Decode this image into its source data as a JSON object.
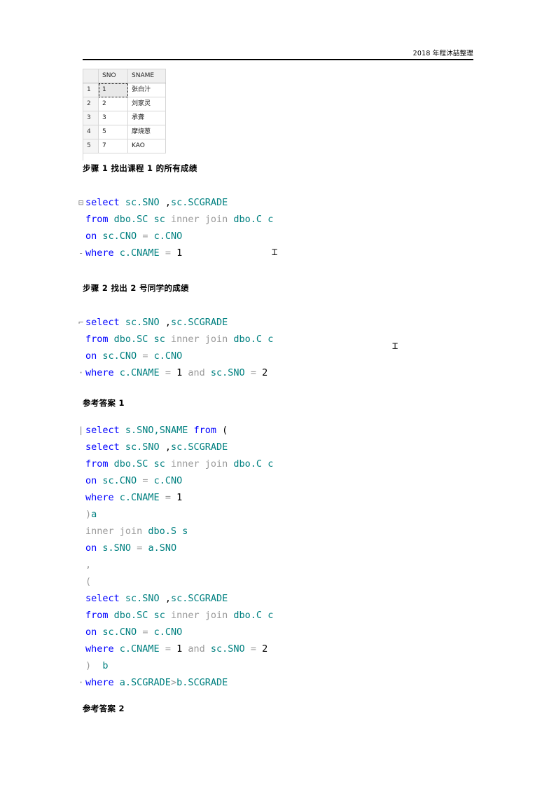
{
  "header": {
    "text": "2018 年程沐喆整理"
  },
  "result_grid": {
    "columns": [
      "",
      "SNO",
      "SNAME"
    ],
    "rows": [
      {
        "n": "1",
        "sno": "1",
        "sname": "张白汁",
        "selected": true
      },
      {
        "n": "2",
        "sno": "2",
        "sname": "刘家灵",
        "selected": false
      },
      {
        "n": "3",
        "sno": "3",
        "sname": "承聋",
        "selected": false
      },
      {
        "n": "4",
        "sno": "5",
        "sname": "摩烧葱",
        "selected": false
      },
      {
        "n": "5",
        "sno": "7",
        "sname": "KAO",
        "selected": false
      }
    ]
  },
  "sections": {
    "step1_heading": "步骤 1  找出课程 1 的所有成绩",
    "step2_heading": "步骤 2 找出 2 号同学的成绩",
    "answer1_heading": "参考答案 1",
    "answer2_heading": "参考答案 2"
  },
  "code_blocks": {
    "step1": {
      "lines": [
        {
          "gutter": "⊟",
          "tokens": [
            {
              "t": "select",
              "c": "kw"
            },
            {
              "t": " ",
              "c": "pl"
            },
            {
              "t": "sc.SNO",
              "c": "id"
            },
            {
              "t": " ,",
              "c": "pl"
            },
            {
              "t": "sc.SCGRADE",
              "c": "id"
            }
          ]
        },
        {
          "gutter": " ",
          "tokens": [
            {
              "t": "from",
              "c": "kw"
            },
            {
              "t": " ",
              "c": "pl"
            },
            {
              "t": "dbo.SC",
              "c": "id"
            },
            {
              "t": " ",
              "c": "pl"
            },
            {
              "t": "sc",
              "c": "id"
            },
            {
              "t": " ",
              "c": "pl"
            },
            {
              "t": "inner join",
              "c": "gry"
            },
            {
              "t": " ",
              "c": "pl"
            },
            {
              "t": "dbo.C",
              "c": "id"
            },
            {
              "t": " ",
              "c": "pl"
            },
            {
              "t": "c",
              "c": "id"
            }
          ]
        },
        {
          "gutter": " ",
          "tokens": [
            {
              "t": "on",
              "c": "kw"
            },
            {
              "t": " ",
              "c": "pl"
            },
            {
              "t": "sc.CNO",
              "c": "id"
            },
            {
              "t": " ",
              "c": "pl"
            },
            {
              "t": "=",
              "c": "gry"
            },
            {
              "t": " ",
              "c": "pl"
            },
            {
              "t": "c.CNO",
              "c": "id"
            }
          ]
        },
        {
          "gutter": "-",
          "tokens": [
            {
              "t": "where",
              "c": "kw"
            },
            {
              "t": " ",
              "c": "pl"
            },
            {
              "t": "c.CNAME",
              "c": "id"
            },
            {
              "t": " ",
              "c": "pl"
            },
            {
              "t": "=",
              "c": "gry"
            },
            {
              "t": " ",
              "c": "pl"
            },
            {
              "t": "1",
              "c": "num"
            }
          ]
        }
      ]
    },
    "step2": {
      "lines": [
        {
          "gutter": "⌐",
          "tokens": [
            {
              "t": "select",
              "c": "kw"
            },
            {
              "t": " ",
              "c": "pl"
            },
            {
              "t": "sc.SNO",
              "c": "id"
            },
            {
              "t": " ,",
              "c": "pl"
            },
            {
              "t": "sc.SCGRADE",
              "c": "id"
            }
          ]
        },
        {
          "gutter": " ",
          "tokens": [
            {
              "t": "from",
              "c": "kw"
            },
            {
              "t": " ",
              "c": "pl"
            },
            {
              "t": "dbo.SC",
              "c": "id"
            },
            {
              "t": " ",
              "c": "pl"
            },
            {
              "t": "sc",
              "c": "id"
            },
            {
              "t": " ",
              "c": "pl"
            },
            {
              "t": "inner join",
              "c": "gry"
            },
            {
              "t": " ",
              "c": "pl"
            },
            {
              "t": "dbo.C",
              "c": "id"
            },
            {
              "t": " ",
              "c": "pl"
            },
            {
              "t": "c",
              "c": "id"
            }
          ]
        },
        {
          "gutter": " ",
          "tokens": [
            {
              "t": "on",
              "c": "kw"
            },
            {
              "t": " ",
              "c": "pl"
            },
            {
              "t": "sc.CNO",
              "c": "id"
            },
            {
              "t": " ",
              "c": "pl"
            },
            {
              "t": "=",
              "c": "gry"
            },
            {
              "t": " ",
              "c": "pl"
            },
            {
              "t": "c.CNO",
              "c": "id"
            }
          ]
        },
        {
          "gutter": "·",
          "tokens": [
            {
              "t": "where",
              "c": "kw"
            },
            {
              "t": " ",
              "c": "pl"
            },
            {
              "t": "c.CNAME",
              "c": "id"
            },
            {
              "t": " ",
              "c": "pl"
            },
            {
              "t": "=",
              "c": "gry"
            },
            {
              "t": " ",
              "c": "pl"
            },
            {
              "t": "1",
              "c": "num"
            },
            {
              "t": " ",
              "c": "pl"
            },
            {
              "t": "and",
              "c": "gry"
            },
            {
              "t": " ",
              "c": "pl"
            },
            {
              "t": "sc.SNO",
              "c": "id"
            },
            {
              "t": " ",
              "c": "pl"
            },
            {
              "t": "=",
              "c": "gry"
            },
            {
              "t": " ",
              "c": "pl"
            },
            {
              "t": "2",
              "c": "num"
            }
          ]
        }
      ]
    },
    "answer1": {
      "lines": [
        {
          "gutter": "|",
          "tokens": [
            {
              "t": "select",
              "c": "kw"
            },
            {
              "t": " ",
              "c": "pl"
            },
            {
              "t": "s.SNO,SNAME",
              "c": "id"
            },
            {
              "t": " ",
              "c": "pl"
            },
            {
              "t": "from",
              "c": "kw"
            },
            {
              "t": " (",
              "c": "pl"
            }
          ]
        },
        {
          "gutter": " ",
          "tokens": [
            {
              "t": "select",
              "c": "kw"
            },
            {
              "t": " ",
              "c": "pl"
            },
            {
              "t": "sc.SNO",
              "c": "id"
            },
            {
              "t": " ,",
              "c": "pl"
            },
            {
              "t": "sc.SCGRADE",
              "c": "id"
            }
          ]
        },
        {
          "gutter": " ",
          "tokens": [
            {
              "t": "from",
              "c": "kw"
            },
            {
              "t": " ",
              "c": "pl"
            },
            {
              "t": "dbo.SC",
              "c": "id"
            },
            {
              "t": " ",
              "c": "pl"
            },
            {
              "t": "sc",
              "c": "id"
            },
            {
              "t": " ",
              "c": "pl"
            },
            {
              "t": "inner join",
              "c": "gry"
            },
            {
              "t": " ",
              "c": "pl"
            },
            {
              "t": "dbo.C",
              "c": "id"
            },
            {
              "t": " ",
              "c": "pl"
            },
            {
              "t": "c",
              "c": "id"
            }
          ]
        },
        {
          "gutter": " ",
          "tokens": [
            {
              "t": "on",
              "c": "kw"
            },
            {
              "t": " ",
              "c": "pl"
            },
            {
              "t": "sc.CNO",
              "c": "id"
            },
            {
              "t": " ",
              "c": "pl"
            },
            {
              "t": "=",
              "c": "gry"
            },
            {
              "t": " ",
              "c": "pl"
            },
            {
              "t": "c.CNO",
              "c": "id"
            }
          ]
        },
        {
          "gutter": " ",
          "tokens": [
            {
              "t": "where",
              "c": "kw"
            },
            {
              "t": " ",
              "c": "pl"
            },
            {
              "t": "c.CNAME",
              "c": "id"
            },
            {
              "t": " ",
              "c": "pl"
            },
            {
              "t": "=",
              "c": "gry"
            },
            {
              "t": " ",
              "c": "pl"
            },
            {
              "t": "1",
              "c": "num"
            }
          ]
        },
        {
          "gutter": " ",
          "tokens": [
            {
              "t": ")",
              "c": "gry"
            },
            {
              "t": "a",
              "c": "alias"
            }
          ]
        },
        {
          "gutter": " ",
          "tokens": [
            {
              "t": "inner join",
              "c": "gry"
            },
            {
              "t": " ",
              "c": "pl"
            },
            {
              "t": "dbo.S",
              "c": "id"
            },
            {
              "t": " ",
              "c": "pl"
            },
            {
              "t": "s",
              "c": "id"
            }
          ]
        },
        {
          "gutter": " ",
          "tokens": [
            {
              "t": "on",
              "c": "kw"
            },
            {
              "t": " ",
              "c": "pl"
            },
            {
              "t": "s.SNO",
              "c": "id"
            },
            {
              "t": " ",
              "c": "pl"
            },
            {
              "t": "=",
              "c": "gry"
            },
            {
              "t": " ",
              "c": "pl"
            },
            {
              "t": "a.SNO",
              "c": "id"
            }
          ]
        },
        {
          "gutter": " ",
          "tokens": [
            {
              "t": ",",
              "c": "gry"
            }
          ]
        },
        {
          "gutter": " ",
          "tokens": [
            {
              "t": "(",
              "c": "gry"
            }
          ]
        },
        {
          "gutter": " ",
          "tokens": [
            {
              "t": "select",
              "c": "kw"
            },
            {
              "t": " ",
              "c": "pl"
            },
            {
              "t": "sc.SNO",
              "c": "id"
            },
            {
              "t": " ,",
              "c": "pl"
            },
            {
              "t": "sc.SCGRADE",
              "c": "id"
            }
          ]
        },
        {
          "gutter": " ",
          "tokens": [
            {
              "t": "from",
              "c": "kw"
            },
            {
              "t": " ",
              "c": "pl"
            },
            {
              "t": "dbo.SC",
              "c": "id"
            },
            {
              "t": " ",
              "c": "pl"
            },
            {
              "t": "sc",
              "c": "id"
            },
            {
              "t": " ",
              "c": "pl"
            },
            {
              "t": "inner join",
              "c": "gry"
            },
            {
              "t": " ",
              "c": "pl"
            },
            {
              "t": "dbo.C",
              "c": "id"
            },
            {
              "t": " ",
              "c": "pl"
            },
            {
              "t": "c",
              "c": "id"
            }
          ]
        },
        {
          "gutter": " ",
          "tokens": [
            {
              "t": "on",
              "c": "kw"
            },
            {
              "t": " ",
              "c": "pl"
            },
            {
              "t": "sc.CNO",
              "c": "id"
            },
            {
              "t": " ",
              "c": "pl"
            },
            {
              "t": "=",
              "c": "gry"
            },
            {
              "t": " ",
              "c": "pl"
            },
            {
              "t": "c.CNO",
              "c": "id"
            }
          ]
        },
        {
          "gutter": " ",
          "tokens": [
            {
              "t": "where",
              "c": "kw"
            },
            {
              "t": " ",
              "c": "pl"
            },
            {
              "t": "c.CNAME",
              "c": "id"
            },
            {
              "t": " ",
              "c": "pl"
            },
            {
              "t": "=",
              "c": "gry"
            },
            {
              "t": " ",
              "c": "pl"
            },
            {
              "t": "1",
              "c": "num"
            },
            {
              "t": " ",
              "c": "pl"
            },
            {
              "t": "and",
              "c": "gry"
            },
            {
              "t": " ",
              "c": "pl"
            },
            {
              "t": "sc.SNO",
              "c": "id"
            },
            {
              "t": " ",
              "c": "pl"
            },
            {
              "t": "=",
              "c": "gry"
            },
            {
              "t": " ",
              "c": "pl"
            },
            {
              "t": "2",
              "c": "num"
            }
          ]
        },
        {
          "gutter": " ",
          "tokens": [
            {
              "t": ")",
              "c": "gry"
            },
            {
              "t": "  ",
              "c": "pl"
            },
            {
              "t": "b",
              "c": "alias"
            }
          ]
        },
        {
          "gutter": "·",
          "tokens": [
            {
              "t": "where",
              "c": "kw"
            },
            {
              "t": " ",
              "c": "pl"
            },
            {
              "t": "a.SCGRADE",
              "c": "id"
            },
            {
              "t": ">",
              "c": "gry"
            },
            {
              "t": "b.SCGRADE",
              "c": "id"
            }
          ]
        }
      ]
    }
  },
  "colors": {
    "keyword": "#0000ff",
    "identifier": "#008080",
    "gray_token": "#9a9a9a",
    "grid_header_bg": "#f0f0f0",
    "grid_border": "#d6d6d6"
  }
}
